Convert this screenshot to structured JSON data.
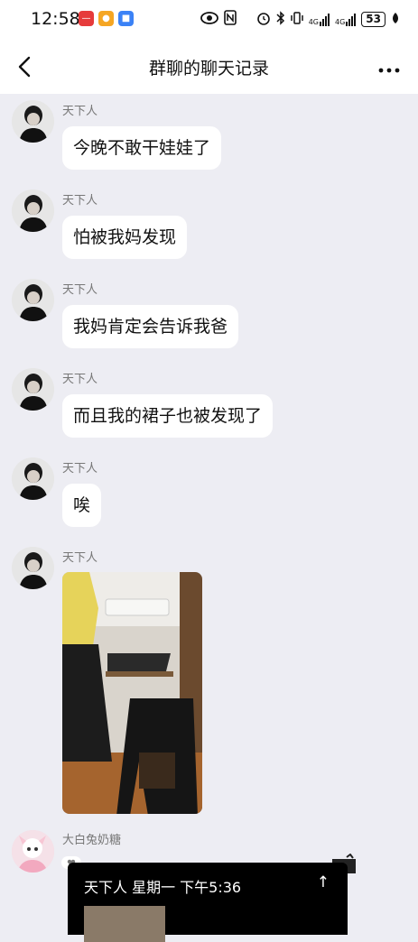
{
  "status_bar": {
    "time": "12:58",
    "battery": "53",
    "signal_a": "4G",
    "signal_b": "4G"
  },
  "header": {
    "title": "群聊的聊天记录"
  },
  "messages": [
    {
      "sender": "天下人",
      "text": "今晚不敢干娃娃了"
    },
    {
      "sender": "天下人",
      "text": "怕被我妈发现"
    },
    {
      "sender": "天下人",
      "text": "我妈肯定会告诉我爸"
    },
    {
      "sender": "天下人",
      "text": "而且我的裙子也被发现了"
    },
    {
      "sender": "天下人",
      "text": "唉"
    },
    {
      "sender": "天下人",
      "type": "image"
    },
    {
      "sender": "大白兔奶糖",
      "type": "forwarded-video",
      "card_text": "天下人 星期一 下午5:36",
      "up_glyph": "↑"
    }
  ]
}
